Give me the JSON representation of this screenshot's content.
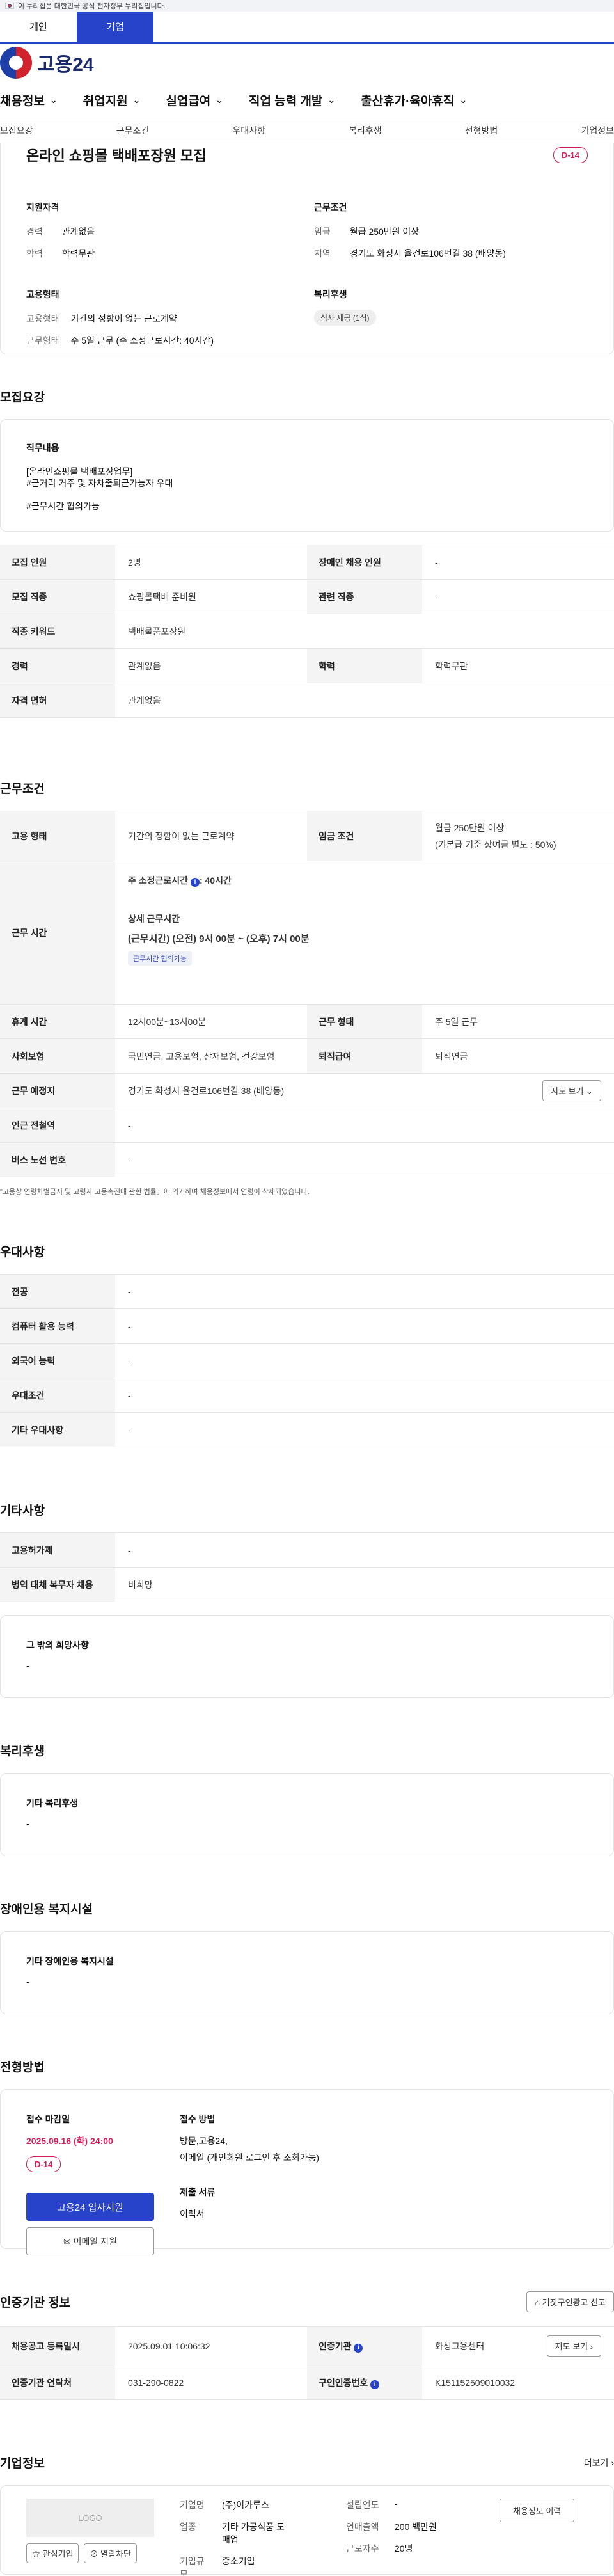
{
  "gov_banner": "이 누리집은 대한민국 공식 전자정부 누리집입니다.",
  "user_tabs": [
    "개인",
    "기업"
  ],
  "logo_text": "고용24",
  "gnb": [
    "채용정보",
    "취업지원",
    "실업급여",
    "직업 능력 개발",
    "출산휴가·육아휴직"
  ],
  "subnav": [
    "모집요강",
    "근무조건",
    "우대사항",
    "복리후생",
    "전형방법",
    "기업정보"
  ],
  "job": {
    "title": "온라인 쇼핑몰 택배포장원 모집",
    "dday": "D-14",
    "qual_heading": "지원자격",
    "career_label": "경력",
    "career_value": "관계없음",
    "edu_label": "학력",
    "edu_value": "학력무관",
    "emp_heading": "고용형태",
    "emp_type_label": "고용형태",
    "emp_type_value": "기간의 정함이 없는 근로계약",
    "work_type_label": "근무형태",
    "work_type_value": "주 5일 근무 (주 소정근로시간: 40시간)",
    "cond_heading": "근무조건",
    "wage_label": "임금",
    "wage_value": "월급 250만원 이상",
    "area_label": "지역",
    "area_value": "경기도 화성시 율건로106번길 38 (배양동)",
    "welfare_heading": "복리후생",
    "welfare_pill": "식사 제공 (1식)"
  },
  "recruit": {
    "title": "모집요강",
    "duty_label": "직무내용",
    "duty_lines": [
      "[온라인쇼핑몰 택배포장업무]",
      "#근거리 거주 및 자차출퇴근가능자 우대",
      "",
      "#근무시간 협의가능"
    ],
    "rows": [
      {
        "k1": "모집 인원",
        "v1": "2명",
        "k2": "장애인 채용 인원",
        "v2": "-"
      },
      {
        "k1": "모집 직종",
        "v1": "쇼핑몰택배 준비원",
        "k2": "관련 직종",
        "v2": "-"
      },
      {
        "k1": "직종 키워드",
        "v1": "택배물품포장원"
      },
      {
        "k1": "경력",
        "v1": "관계없음",
        "k2": "학력",
        "v2": "학력무관"
      },
      {
        "k1": "자격 면허",
        "v1": "관계없음"
      }
    ]
  },
  "conditions": {
    "title": "근무조건",
    "emp_type_label": "고용 형태",
    "emp_type_value": "기간의 정함이 없는 근로계약",
    "wage_label": "임금 조건",
    "wage_value1": "월급 250만원 이상",
    "wage_value2": "(기본급 기준 상여금 별도 : 50%)",
    "hours_label": "근무 시간",
    "hours_weekly": "주 소정근로시간 ",
    "hours_weekly_value": ": 40시간",
    "hours_detail_label": "상세 근무시간",
    "hours_detail_value": "(근무시간) (오전) 9시 00분 ~ (오후) 7시 00분",
    "hours_tag": "근무시간 협의가능",
    "break_label": "휴게 시간",
    "break_value": "12시00분~13시00분",
    "workform_label": "근무 형태",
    "workform_value": "주 5일 근무",
    "insurance_label": "사회보험",
    "insurance_value": "국민연금, 고용보험, 산재보험, 건강보험",
    "retire_label": "퇴직급여",
    "retire_value": "퇴직연금",
    "place_label": "근무 예정지",
    "place_value": "경기도 화성시 율건로106번길 38 (배양동)",
    "map_btn": "지도 보기",
    "subway_label": "인근 전철역",
    "subway_value": "-",
    "bus_label": "버스 노선 번호",
    "bus_value": "-",
    "notice": "\"고용상 연령차별금지 및 고령자 고용촉진에 관한 법률」에 의거하여 채용정보에서 연령이 삭제되었습니다."
  },
  "prefer": {
    "title": "우대사항",
    "rows": [
      {
        "k": "전공",
        "v": "-"
      },
      {
        "k": "컴퓨터 활용 능력",
        "v": "-"
      },
      {
        "k": "외국어 능력",
        "v": "-"
      },
      {
        "k": "우대조건",
        "v": "-"
      },
      {
        "k": "기타 우대사항",
        "v": "-"
      }
    ]
  },
  "etc": {
    "title": "기타사항",
    "rows": [
      {
        "k": "고용허가제",
        "v": "-"
      },
      {
        "k": "병역 대체 복무자 채용",
        "v": "비희망"
      }
    ],
    "hope_label": "그 밖의 희망사항",
    "hope_value": "-"
  },
  "welfare": {
    "title": "복리후생",
    "label": "기타 복리후생",
    "value": "-"
  },
  "disability": {
    "title": "장애인용 복지시설",
    "label": "기타 장애인용 복지시설",
    "value": "-"
  },
  "apply": {
    "title": "전형방법",
    "deadline_label": "접수 마감일",
    "deadline_value": "2025.09.16 (화) 24:00",
    "dday": "D-14",
    "apply_btn": "고용24 입사지원",
    "email_btn": "이메일 지원",
    "method_label": "접수 방법",
    "method_value1": "방문,고용24,",
    "method_value2": "이메일 (개인회원 로그인 후 조회가능)",
    "docs_label": "제출 서류",
    "docs_value": "이력서"
  },
  "agency": {
    "title": "인증기관 정보",
    "report_btn": "거짓구인광고 신고",
    "reg_label": "채용공고 등록일시",
    "reg_value": "2025.09.01 10:06:32",
    "org_label": "인증기관",
    "org_value": "화성고용센터",
    "map_btn": "지도 보기",
    "tel_label": "인증기관 연락처",
    "tel_value": "031-290-0822",
    "no_label": "구인인증번호",
    "no_value": "K151152509010032"
  },
  "company": {
    "title": "기업정보",
    "more": "더보기",
    "logo_text": "LOGO",
    "interest_btn": "관심기업",
    "block_btn": "열람차단",
    "name_label": "기업명",
    "name_value": "(주)이카루스",
    "industry_label": "업종",
    "industry_value1": "기타 가공식품 도",
    "industry_value2": "매업",
    "size_label": "기업규모",
    "size_value": "중소기업",
    "founded_label": "설립연도",
    "founded_value": "-",
    "sales_label": "연매출액",
    "sales_value": "200 백만원",
    "staff_label": "근로자수",
    "staff_value": "20명",
    "hire_info_btn": "채용정보 이력"
  }
}
